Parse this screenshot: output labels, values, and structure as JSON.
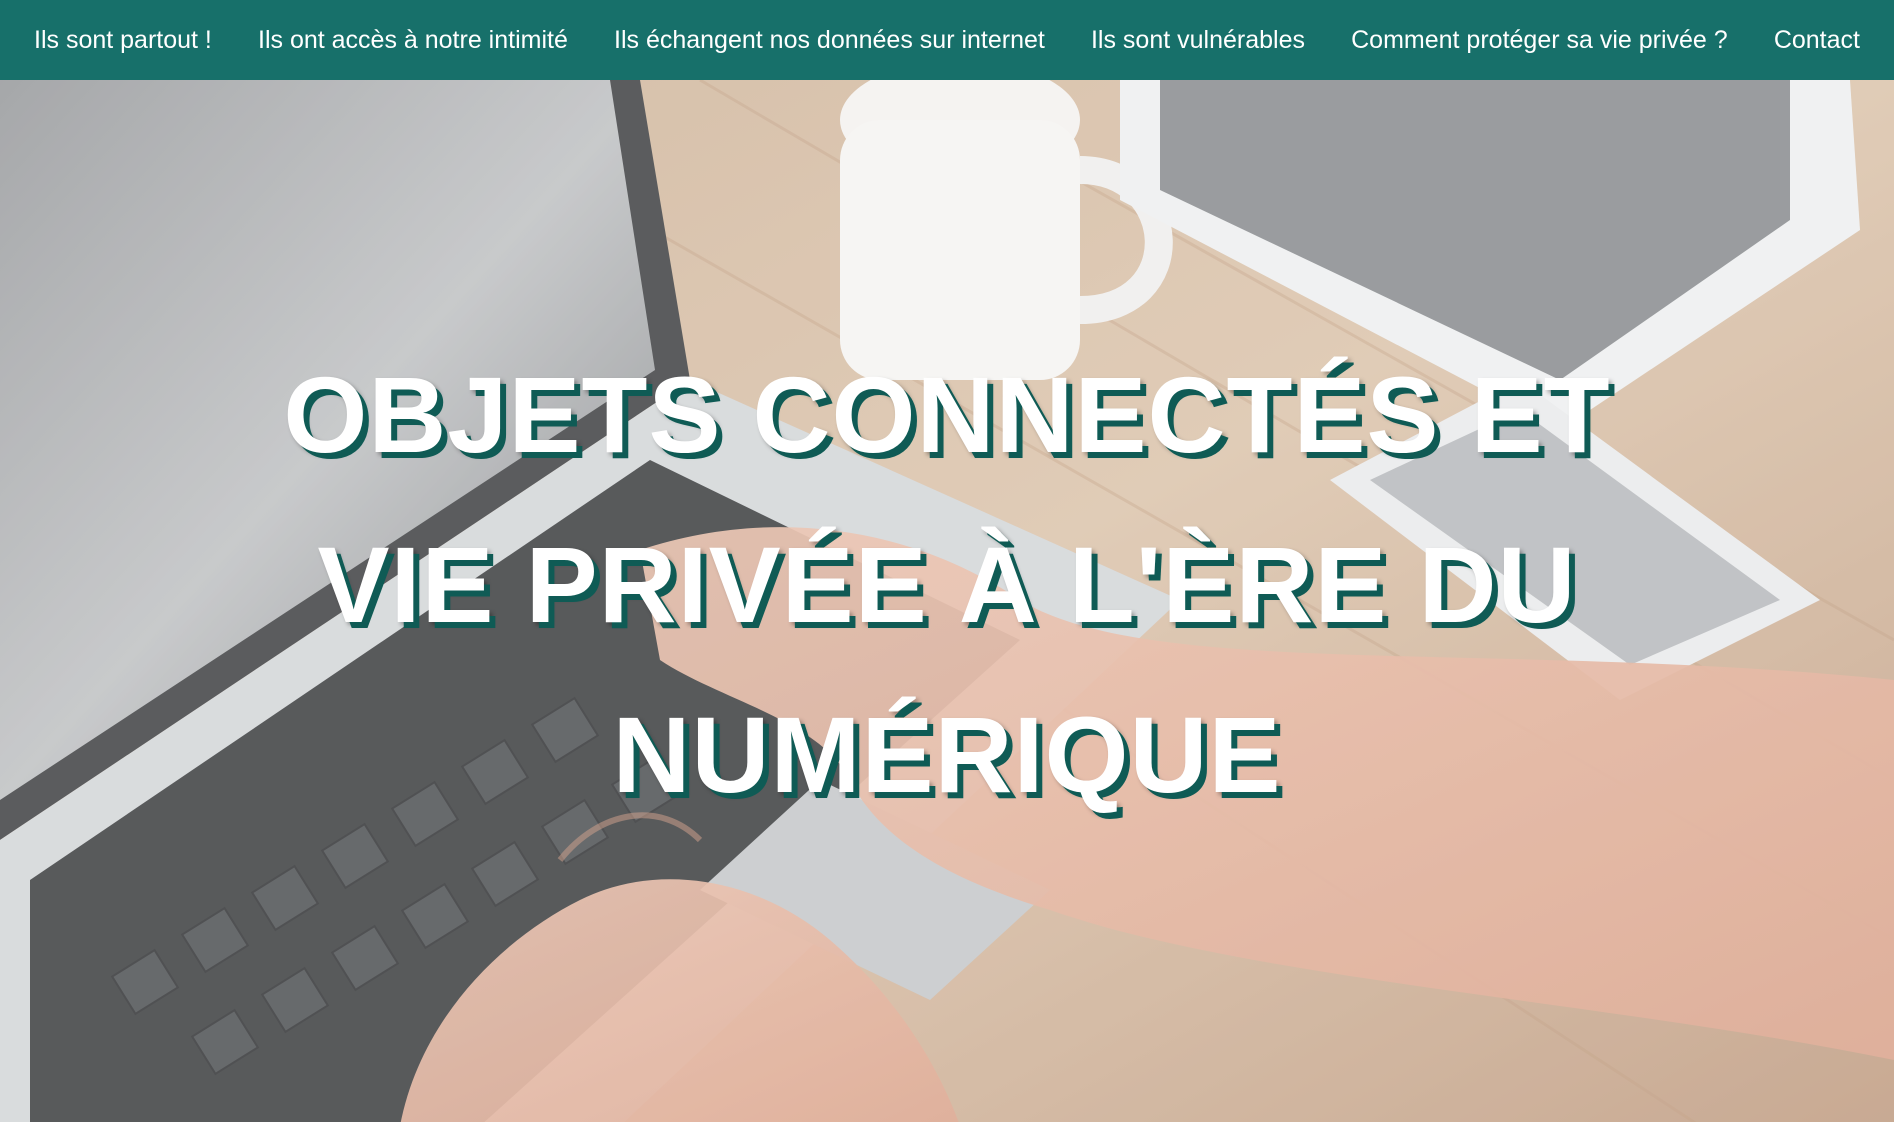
{
  "nav": {
    "items": [
      {
        "label": "Ils sont partout !"
      },
      {
        "label": "Ils ont accès à notre intimité"
      },
      {
        "label": "Ils échangent nos données sur internet"
      },
      {
        "label": "Ils sont vulnérables"
      },
      {
        "label": "Comment protéger sa vie privée ?"
      },
      {
        "label": "Contact"
      }
    ]
  },
  "hero": {
    "title_line1": "OBJETS CONNECTÉS ET",
    "title_line2": "VIE PRIVÉE À L'ÈRE DU",
    "title_line3": "NUMÉRIQUE"
  },
  "colors": {
    "nav_background": "#17706a",
    "title_shadow": "#0f5b55",
    "text": "#ffffff"
  }
}
